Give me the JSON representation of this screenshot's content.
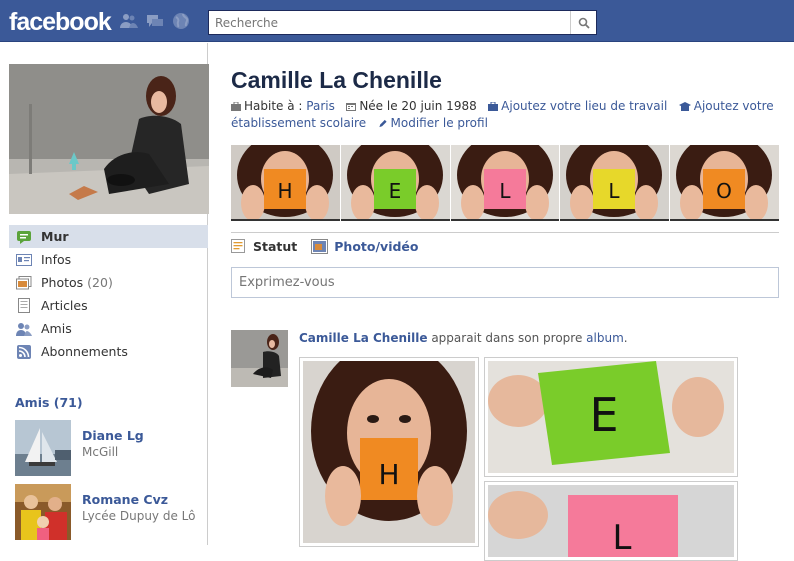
{
  "brand": {
    "logo_text": "facebook",
    "color": "#3b5998"
  },
  "topbar": {
    "search_placeholder": "Recherche",
    "icons": [
      "friends-icon",
      "messages-icon",
      "globe-icon",
      "search-icon"
    ]
  },
  "profile": {
    "name": "Camille La Chenille",
    "info": {
      "lives_prefix": "Habite à :",
      "city": "Paris",
      "born": "Née le 20 juin 1988",
      "add_work": "Ajoutez votre lieu de travail",
      "add_school": "Ajoutez votre établissement scolaire",
      "edit_profile": "Modifier le profil"
    },
    "strip_letters": [
      "H",
      "E",
      "L",
      "L",
      "O"
    ],
    "strip_colors": [
      "#f08a22",
      "#7acc2a",
      "#f57a9a",
      "#e7d82a",
      "#f08a22"
    ]
  },
  "sidebar": {
    "items": [
      {
        "label": "Mur",
        "icon": "wall-icon",
        "active": true
      },
      {
        "label": "Infos",
        "icon": "info-icon"
      },
      {
        "label": "Photos",
        "count": "(20)",
        "icon": "photos-icon"
      },
      {
        "label": "Articles",
        "icon": "notes-icon"
      },
      {
        "label": "Amis",
        "icon": "friends-icon"
      },
      {
        "label": "Abonnements",
        "icon": "subscriptions-icon"
      }
    ],
    "friends": {
      "title": "Amis (71)",
      "list": [
        {
          "name": "Diane Lg",
          "sub": "McGill"
        },
        {
          "name": "Romane Cvz",
          "sub": "Lycée Dupuy de Lô"
        }
      ]
    }
  },
  "composer": {
    "tabs": [
      {
        "label": "Statut",
        "icon": "status-icon"
      },
      {
        "label": "Photo/vidéo",
        "icon": "photo-icon"
      }
    ],
    "placeholder": "Exprimez-vous"
  },
  "story": {
    "author": "Camille La Chenille",
    "mid": " apparait dans son propre ",
    "link": "album",
    "end": ".",
    "album_letters": [
      "H",
      "E",
      "L"
    ]
  }
}
